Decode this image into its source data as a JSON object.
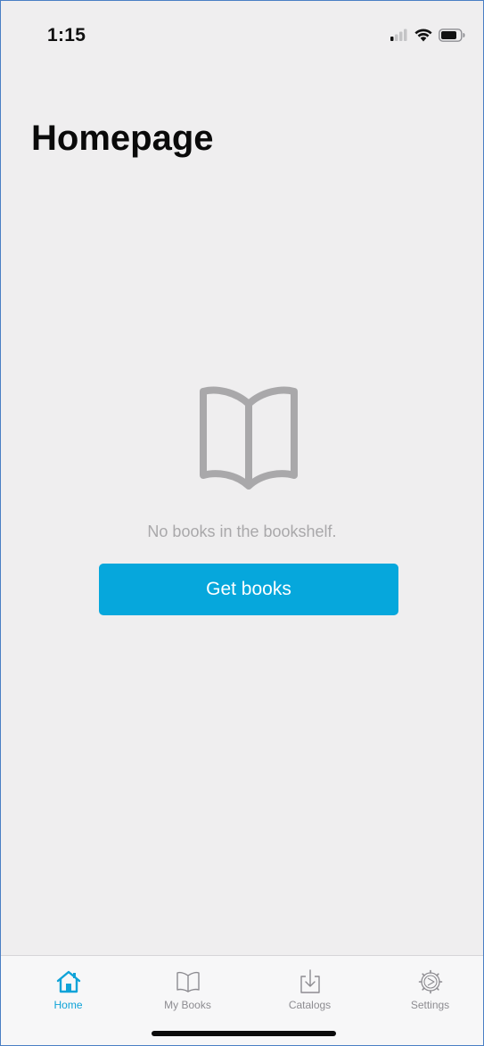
{
  "status_bar": {
    "time": "1:15"
  },
  "page": {
    "title": "Homepage"
  },
  "empty_state": {
    "icon": "open-book-icon",
    "message": "No books in the bookshelf.",
    "button_label": "Get books"
  },
  "tab_bar": {
    "tabs": [
      {
        "label": "Home",
        "icon": "home-icon",
        "active": true
      },
      {
        "label": "My Books",
        "icon": "book-icon",
        "active": false
      },
      {
        "label": "Catalogs",
        "icon": "download-icon",
        "active": false
      },
      {
        "label": "Settings",
        "icon": "gear-icon",
        "active": false
      }
    ]
  },
  "colors": {
    "accent": "#06a7dc",
    "background": "#efeeef",
    "muted_text": "#a9a8aa",
    "tab_inactive": "#8d8c91"
  }
}
